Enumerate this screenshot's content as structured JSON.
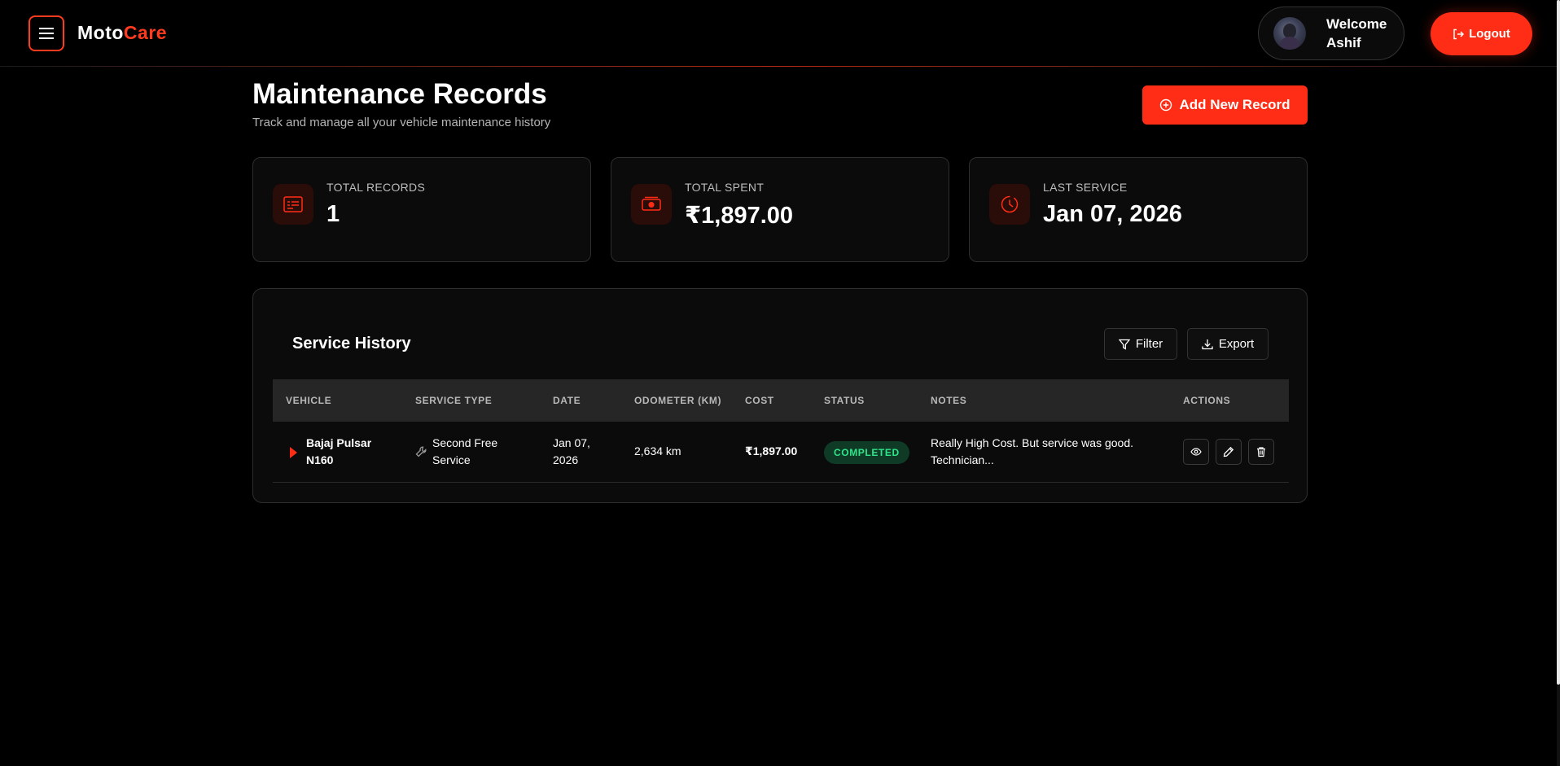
{
  "header": {
    "brand_part1": "Moto",
    "brand_part2": "Care",
    "welcome_line1": "Welcome",
    "welcome_line2": "Ashif",
    "logout_label": "Logout"
  },
  "page": {
    "title": "Maintenance Records",
    "subtitle": "Track and manage all your vehicle maintenance history",
    "add_label": "Add New Record"
  },
  "stats": [
    {
      "label": "TOTAL RECORDS",
      "value": "1",
      "icon": "document-list-icon"
    },
    {
      "label": "TOTAL SPENT",
      "value": "₹1,897.00",
      "icon": "money-icon"
    },
    {
      "label": "LAST SERVICE",
      "value": "Jan 07, 2026",
      "icon": "clock-icon"
    }
  ],
  "history": {
    "title": "Service History",
    "filter_label": "Filter",
    "export_label": "Export",
    "columns": [
      "VEHICLE",
      "SERVICE TYPE",
      "DATE",
      "ODOMETER (KM)",
      "COST",
      "STATUS",
      "NOTES",
      "ACTIONS"
    ],
    "rows": [
      {
        "vehicle_line1": "Bajaj Pulsar",
        "vehicle_line2": "N160",
        "service_line1": "Second Free",
        "service_line2": "Service",
        "date_line1": "Jan 07,",
        "date_line2": "2026",
        "odometer": "2,634 km",
        "cost": "₹1,897.00",
        "status": "COMPLETED",
        "notes_line1": "Really High Cost. But service was good.",
        "notes_line2": "Technician..."
      }
    ]
  },
  "colors": {
    "accent": "#ff2d15",
    "background": "#000000",
    "card": "#0b0b0b",
    "status_completed": "#2ee58a"
  }
}
